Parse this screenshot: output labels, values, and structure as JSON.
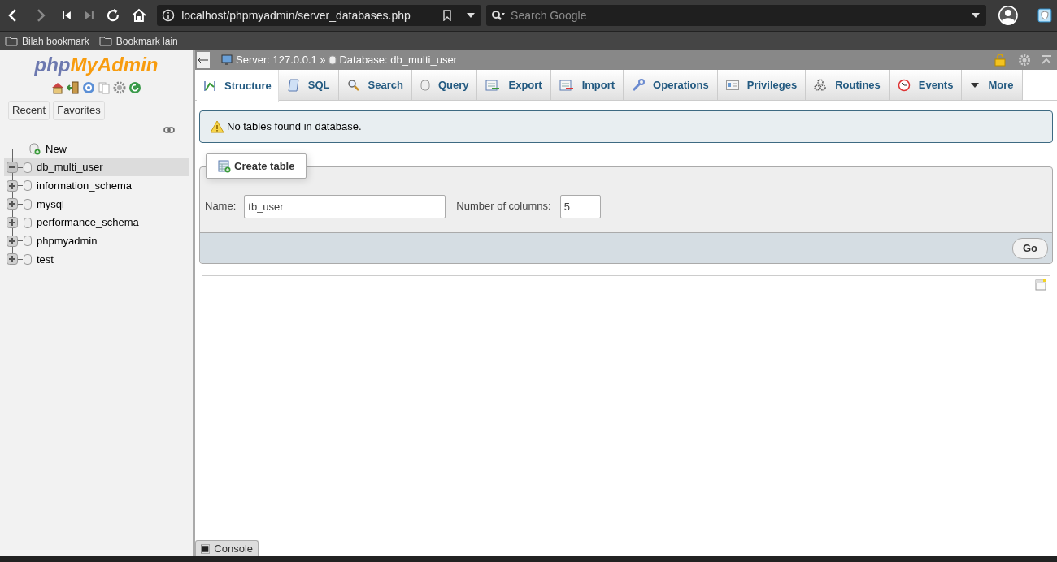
{
  "browser": {
    "url": "localhost/phpmyadmin/server_databases.php",
    "search_placeholder": "Search Google",
    "bookmarks": [
      "Bilah bookmark",
      "Bookmark lain"
    ]
  },
  "sidebar": {
    "logo": [
      "php",
      "MyAdmin"
    ],
    "buttons": [
      "Recent",
      "Favorites"
    ],
    "tree": [
      {
        "label": "New",
        "kind": "new",
        "selected": false
      },
      {
        "label": "db_multi_user",
        "kind": "db",
        "expanded": true,
        "selected": true
      },
      {
        "label": "information_schema",
        "kind": "db",
        "expanded": false,
        "selected": false
      },
      {
        "label": "mysql",
        "kind": "db",
        "expanded": false,
        "selected": false
      },
      {
        "label": "performance_schema",
        "kind": "db",
        "expanded": false,
        "selected": false
      },
      {
        "label": "phpmyadmin",
        "kind": "db",
        "expanded": false,
        "selected": false
      },
      {
        "label": "test",
        "kind": "db",
        "expanded": false,
        "selected": false
      }
    ]
  },
  "breadcrumb": {
    "server": "Server: 127.0.0.1",
    "separator": "»",
    "database": "Database: db_multi_user"
  },
  "tabs": [
    {
      "label": "Structure",
      "selected": true
    },
    {
      "label": "SQL",
      "selected": false
    },
    {
      "label": "Search",
      "selected": false
    },
    {
      "label": "Query",
      "selected": false
    },
    {
      "label": "Export",
      "selected": false
    },
    {
      "label": "Import",
      "selected": false
    },
    {
      "label": "Operations",
      "selected": false
    },
    {
      "label": "Privileges",
      "selected": false
    },
    {
      "label": "Routines",
      "selected": false
    },
    {
      "label": "Events",
      "selected": false
    },
    {
      "label": "More",
      "selected": false
    }
  ],
  "notice": "No tables found in database.",
  "create_table": {
    "title": "Create table",
    "name_label": "Name:",
    "name_value": "tb_user",
    "columns_label": "Number of columns:",
    "columns_value": "5",
    "go_button": "Go"
  },
  "console": "Console"
}
